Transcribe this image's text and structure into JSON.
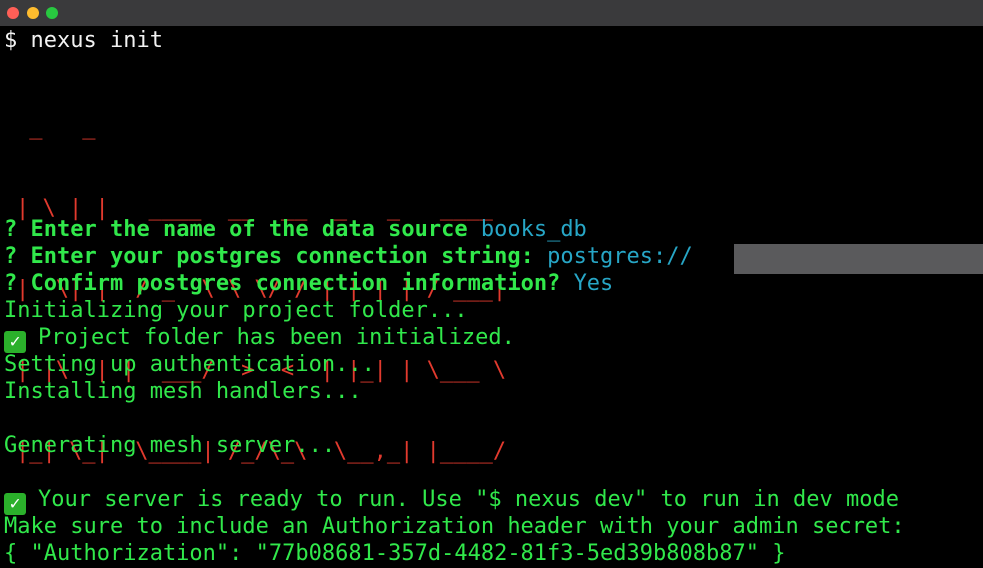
{
  "terminal": {
    "command": "$ nexus init",
    "banner_lines": [
      " _   _",
      "| \\ | |   ____  __  __  _   _   ____",
      "|  \\| |  / _  \\ \\ \\/ / | | | | / ___|",
      "| |\\  | |  ___/  >  <  | |_| | \\___ \\",
      "|_| \\_|  \\____| /_/\\_\\  \\__,_| |____/"
    ],
    "prompts": [
      {
        "mark": "?",
        "question": "Enter the name of the data source",
        "answer": "books_db"
      },
      {
        "mark": "?",
        "question": "Enter your postgres connection string:",
        "answer": "postgres://"
      },
      {
        "mark": "?",
        "question": "Confirm postgres connection information?",
        "answer": "Yes"
      }
    ],
    "output": {
      "init_folder": "Initializing your project folder...",
      "folder_done": "Project folder has been initialized.",
      "auth": "Setting up authentication...",
      "mesh_handlers": "Installing mesh handlers...",
      "generating": "Generating mesh server...",
      "ready": "Your server is ready to run. Use \"$ nexus dev\" to run in dev mode",
      "make_sure": "Make sure to include an Authorization header with your admin secret:",
      "auth_json": "{ \"Authorization\": \"77b08681-357d-4482-81f3-5ed39b808b87\" }"
    },
    "check_icon": "white-check-mark-icon"
  },
  "colors": {
    "output_green": "#31e84b",
    "answer_cyan": "#27a6c6",
    "banner_red": "#e23a2e",
    "background": "#000000"
  }
}
